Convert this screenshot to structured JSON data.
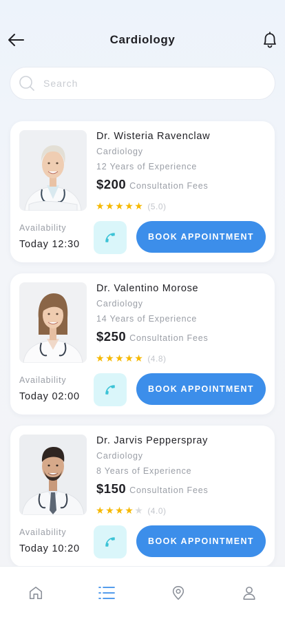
{
  "header": {
    "title": "Cardiology",
    "back_icon": "arrow-left-icon",
    "notification_icon": "bell-icon"
  },
  "search": {
    "placeholder": "Search",
    "value": "",
    "icon": "search-icon"
  },
  "doctors": [
    {
      "name": "Dr. Wisteria Ravenclaw",
      "specialty": "Cardiology",
      "experience": "12 Years of Experience",
      "fee": "$200",
      "fee_label": "Consultation Fees",
      "stars_filled": 5,
      "stars_total": 5,
      "rating_text": "(5.0)",
      "availability_label": "Availability",
      "availability_time": "Today 12:30",
      "book_label": "BOOK APPOINTMENT"
    },
    {
      "name": "Dr. Valentino Morose",
      "specialty": "Cardiology",
      "experience": "14 Years of Experience",
      "fee": "$250",
      "fee_label": "Consultation Fees",
      "stars_filled": 5,
      "stars_total": 5,
      "rating_text": "(4.8)",
      "availability_label": "Availability",
      "availability_time": "Today 02:00",
      "book_label": "BOOK APPOINTMENT"
    },
    {
      "name": "Dr. Jarvis Pepperspray",
      "specialty": "Cardiology",
      "experience": "8 Years of Experience",
      "fee": "$150",
      "fee_label": "Consultation Fees",
      "stars_filled": 4,
      "stars_total": 5,
      "rating_text": "(4.0)",
      "availability_label": "Availability",
      "availability_time": "Today 10:20",
      "book_label": "BOOK APPOINTMENT"
    }
  ],
  "bottom_nav": {
    "items": [
      {
        "icon": "home-icon",
        "active": false
      },
      {
        "icon": "list-icon",
        "active": true
      },
      {
        "icon": "location-pin-icon",
        "active": false
      },
      {
        "icon": "profile-icon",
        "active": false
      }
    ]
  },
  "colors": {
    "accent": "#3c8eea",
    "call_bg": "#daf6fa",
    "call_icon": "#3cc3d6",
    "star": "#f6b800",
    "star_empty": "#d9dbde",
    "nav_active": "#3c8eea",
    "nav_inactive": "#8a8f98"
  }
}
